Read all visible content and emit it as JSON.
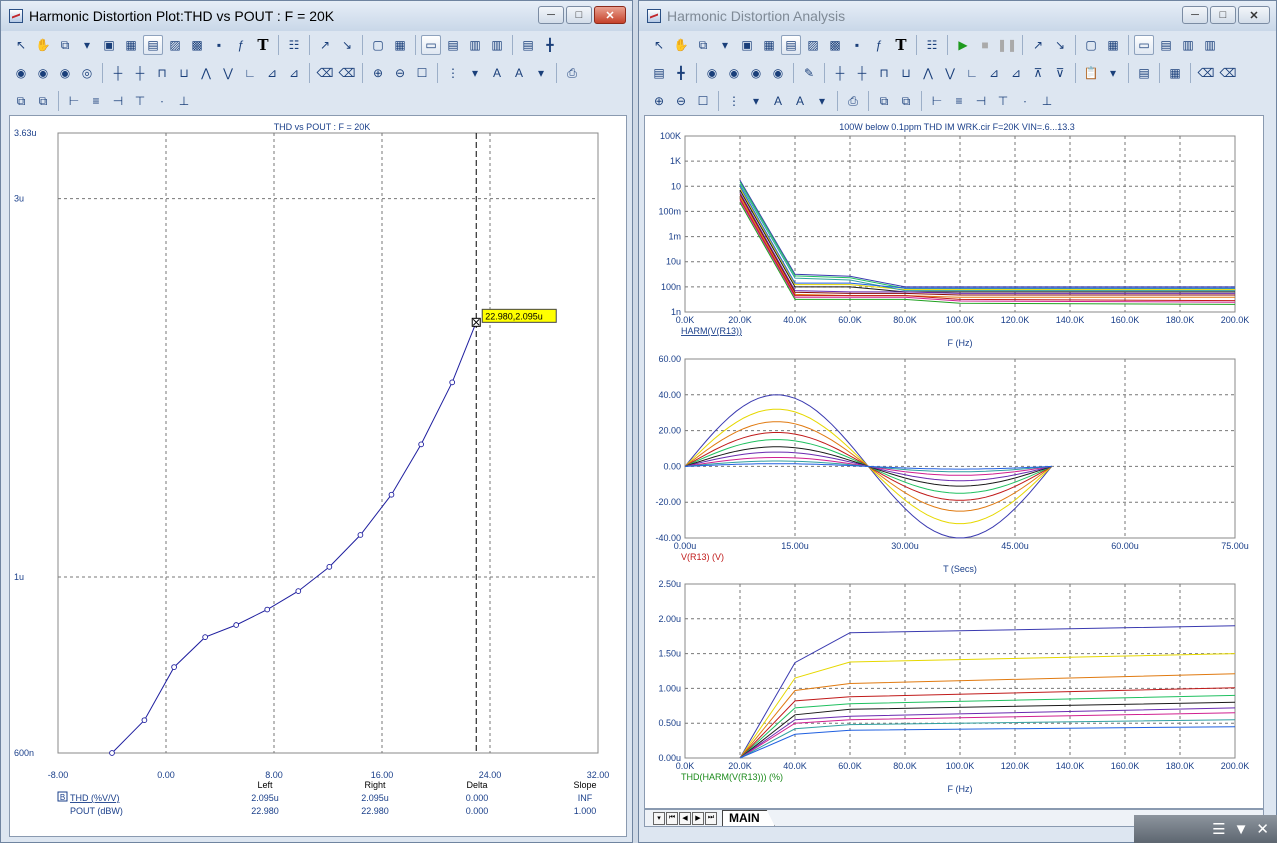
{
  "left_window": {
    "title": "Harmonic Distortion Plot:THD vs POUT : F = 20K",
    "plot_title": "THD vs POUT : F = 20K",
    "y_ticks": [
      "3.63u",
      "3u",
      "1u",
      "600n"
    ],
    "x_ticks": [
      "-8.00",
      "0.00",
      "8.00",
      "16.00",
      "24.00",
      "32.00"
    ],
    "cursor_label": "22.980,2.095u",
    "readout": {
      "headers": [
        "Left",
        "Right",
        "Delta",
        "Slope"
      ],
      "rows": [
        {
          "marker": "B",
          "label": "THD (%V/V)",
          "values": [
            "2.095u",
            "2.095u",
            "0.000",
            "INF"
          ]
        },
        {
          "marker": "",
          "label": "POUT (dBW)",
          "values": [
            "22.980",
            "22.980",
            "0.000",
            "1.000"
          ]
        }
      ]
    }
  },
  "right_window": {
    "title": "Harmonic Distortion Analysis",
    "plot_title": "100W below 0.1ppm THD IM WRK.cir F=20K VIN=.6...13.3",
    "plot1": {
      "y_ticks": [
        "100K",
        "1K",
        "10",
        "100m",
        "1m",
        "10u",
        "100n",
        "1n"
      ],
      "x_ticks": [
        "0.0K",
        "20.0K",
        "40.0K",
        "60.0K",
        "80.0K",
        "100.0K",
        "120.0K",
        "140.0K",
        "160.0K",
        "180.0K",
        "200.0K"
      ],
      "trace_label": "HARM(V(R13))",
      "xlabel": "F (Hz)"
    },
    "plot2": {
      "y_ticks": [
        "60.00",
        "40.00",
        "20.00",
        "0.00",
        "-20.00",
        "-40.00"
      ],
      "x_ticks": [
        "0.00u",
        "15.00u",
        "30.00u",
        "45.00u",
        "60.00u",
        "75.00u"
      ],
      "trace_label": "V(R13) (V)",
      "xlabel": "T (Secs)"
    },
    "plot3": {
      "y_ticks": [
        "2.50u",
        "2.00u",
        "1.50u",
        "1.00u",
        "0.50u",
        "0.00u"
      ],
      "x_ticks": [
        "0.0K",
        "20.0K",
        "40.0K",
        "60.0K",
        "80.0K",
        "100.0K",
        "120.0K",
        "140.0K",
        "160.0K",
        "180.0K",
        "200.0K"
      ],
      "trace_label": "THD(HARM(V(R13))) (%)",
      "xlabel": "F (Hz)"
    },
    "tab": "MAIN"
  },
  "colors": {
    "curve": "#1f1f9f",
    "cursor_box": "#ffff00",
    "traces": [
      "#3a3ab0",
      "#e6d800",
      "#e07a10",
      "#c01a1a",
      "#20c060",
      "#1a1a1a",
      "#6a2ab0",
      "#d02090",
      "#30a0a0",
      "#2060e0",
      "#8a0a0a",
      "#20a020"
    ]
  },
  "chart_data": [
    {
      "type": "line",
      "title": "THD vs POUT : F = 20K",
      "xlabel": "POUT (dBW)",
      "ylabel": "THD (%V/V)",
      "xlim": [
        -8,
        32
      ],
      "ylim": [
        6e-07,
        3.63e-06
      ],
      "y_scale": "log",
      "grid": true,
      "series": [
        {
          "name": "THD (%V/V)",
          "x": [
            -4.0,
            -1.6,
            0.6,
            2.9,
            5.2,
            7.5,
            9.8,
            12.1,
            14.4,
            16.7,
            18.9,
            21.2,
            22.98
          ],
          "y": [
            6e-07,
            6.6e-07,
            7.7e-07,
            8.4e-07,
            8.7e-07,
            9.1e-07,
            9.6e-07,
            1.03e-06,
            1.13e-06,
            1.27e-06,
            1.47e-06,
            1.76e-06,
            2.095e-06
          ]
        }
      ]
    },
    {
      "type": "line",
      "xlabel": "F (Hz)",
      "ylabel": "HARM(V(R13))",
      "xlim": [
        0,
        200000
      ],
      "ylim": [
        1e-09,
        100000
      ],
      "y_scale": "log",
      "grid": true,
      "series": [
        {
          "name": "HARM(V(R13))",
          "x": [
            20000,
            40000,
            60000,
            80000,
            100000,
            200000
          ],
          "y": [
            30,
            1e-06,
            7e-07,
            1e-07,
            1e-07,
            1e-07
          ]
        },
        {
          "name": "HARM(V(R13))",
          "x": [
            20000,
            40000,
            60000,
            80000,
            100000,
            200000
          ],
          "y": [
            10,
            2e-07,
            2e-07,
            8e-08,
            8e-08,
            8e-08
          ]
        },
        {
          "name": "HARM(V(R13))",
          "x": [
            20000,
            40000,
            60000,
            80000,
            100000,
            200000
          ],
          "y": [
            3,
            5e-08,
            4e-08,
            4e-08,
            3e-08,
            3e-08
          ]
        },
        {
          "name": "HARM(V(R13))",
          "x": [
            20000,
            40000,
            60000,
            80000,
            100000,
            200000
          ],
          "y": [
            1,
            2e-08,
            2e-08,
            2e-08,
            1e-08,
            8e-09
          ]
        }
      ]
    },
    {
      "type": "line",
      "xlabel": "T (Secs)",
      "ylabel": "V(R13) (V)",
      "xlim": [
        0,
        75
      ],
      "ylim": [
        -40,
        60
      ],
      "grid": true,
      "series": [
        {
          "name": "V(R13) (V)",
          "amplitude": 40,
          "period_us": 50
        },
        {
          "name": "V(R13) (V)",
          "amplitude": 32,
          "period_us": 50
        },
        {
          "name": "V(R13) (V)",
          "amplitude": 25,
          "period_us": 50
        },
        {
          "name": "V(R13) (V)",
          "amplitude": 19,
          "period_us": 50
        },
        {
          "name": "V(R13) (V)",
          "amplitude": 15,
          "period_us": 50
        },
        {
          "name": "V(R13) (V)",
          "amplitude": 11,
          "period_us": 50
        },
        {
          "name": "V(R13) (V)",
          "amplitude": 8,
          "period_us": 50
        },
        {
          "name": "V(R13) (V)",
          "amplitude": 5,
          "period_us": 50
        },
        {
          "name": "V(R13) (V)",
          "amplitude": 3,
          "period_us": 50
        },
        {
          "name": "V(R13) (V)",
          "amplitude": 1.5,
          "period_us": 50
        }
      ]
    },
    {
      "type": "line",
      "xlabel": "F (Hz)",
      "ylabel": "THD(HARM(V(R13))) (%)",
      "xlim": [
        0,
        200000
      ],
      "ylim": [
        0,
        2.5e-06
      ],
      "grid": true,
      "series": [
        {
          "name": "THD(HARM(V(R13))) (%)",
          "x": [
            20000,
            40000,
            60000,
            200000
          ],
          "y": [
            0,
            1.37e-06,
            1.8e-06,
            1.9e-06
          ]
        },
        {
          "name": "THD(HARM(V(R13))) (%)",
          "x": [
            20000,
            40000,
            60000,
            200000
          ],
          "y": [
            0,
            1.15e-06,
            1.38e-06,
            1.5e-06
          ]
        },
        {
          "name": "THD(HARM(V(R13))) (%)",
          "x": [
            20000,
            40000,
            60000,
            200000
          ],
          "y": [
            0,
            9.7e-07,
            1.07e-06,
            1.21e-06
          ]
        },
        {
          "name": "THD(HARM(V(R13))) (%)",
          "x": [
            20000,
            40000,
            60000,
            200000
          ],
          "y": [
            0,
            8.2e-07,
            8.8e-07,
            1.01e-06
          ]
        },
        {
          "name": "THD(HARM(V(R13))) (%)",
          "x": [
            20000,
            40000,
            60000,
            200000
          ],
          "y": [
            0,
            7.2e-07,
            7.8e-07,
            9e-07
          ]
        },
        {
          "name": "THD(HARM(V(R13))) (%)",
          "x": [
            20000,
            40000,
            60000,
            200000
          ],
          "y": [
            0,
            6.2e-07,
            7e-07,
            8e-07
          ]
        },
        {
          "name": "THD(HARM(V(R13))) (%)",
          "x": [
            20000,
            40000,
            60000,
            200000
          ],
          "y": [
            0,
            5.5e-07,
            6e-07,
            7.2e-07
          ]
        },
        {
          "name": "THD(HARM(V(R13))) (%)",
          "x": [
            20000,
            40000,
            60000,
            200000
          ],
          "y": [
            0,
            5e-07,
            5.5e-07,
            6.5e-07
          ]
        },
        {
          "name": "THD(HARM(V(R13))) (%)",
          "x": [
            20000,
            40000,
            60000,
            200000
          ],
          "y": [
            0,
            4.2e-07,
            4.8e-07,
            5.5e-07
          ]
        },
        {
          "name": "THD(HARM(V(R13))) (%)",
          "x": [
            20000,
            40000,
            60000,
            200000
          ],
          "y": [
            0,
            3.4e-07,
            4e-07,
            4.5e-07
          ]
        }
      ]
    }
  ]
}
